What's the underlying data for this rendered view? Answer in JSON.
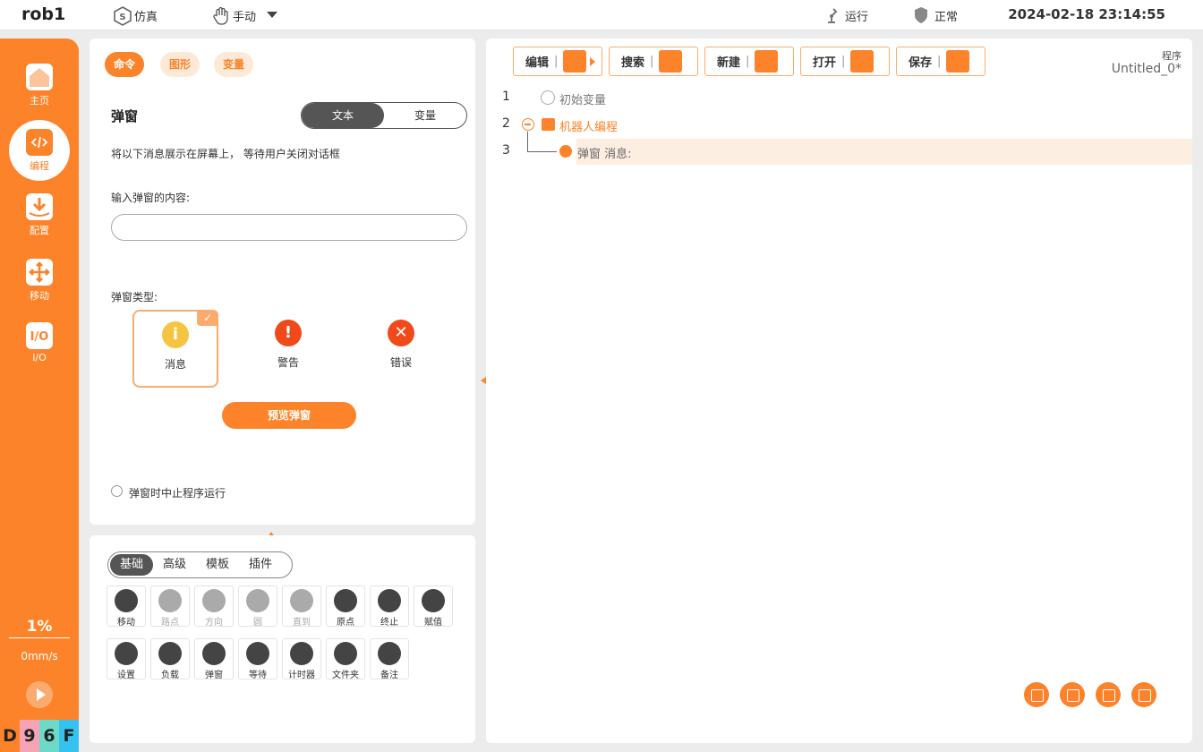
{
  "topbar": {
    "robot_name": "rob1",
    "mode": "仿真",
    "control": "手动",
    "run_status": "运行",
    "safety_status": "正常",
    "datetime": "2024-02-18 23:14:55"
  },
  "sidebar": {
    "items": [
      {
        "label": "主页",
        "icon": "home-icon"
      },
      {
        "label": "编程",
        "icon": "code-icon"
      },
      {
        "label": "配置",
        "icon": "download-icon"
      },
      {
        "label": "移动",
        "icon": "move-icon"
      },
      {
        "label": "I/O",
        "icon": "io-icon"
      }
    ],
    "speed_percent": "1%",
    "speed_value": "0mm/s",
    "code_chars": [
      "D",
      "9",
      "6",
      "F"
    ],
    "code_colors": [
      "#fc8329",
      "#f5a3b5",
      "#6fd9c8",
      "#35c2f0"
    ]
  },
  "command_panel": {
    "tabs": [
      "命令",
      "图形",
      "变量"
    ],
    "title": "弹窗",
    "segment": [
      "文本",
      "变量"
    ],
    "description": "将以下消息展示在屏幕上， 等待用户关闭对话框",
    "input_label": "输入弹窗的内容:",
    "input_value": "",
    "type_label": "弹窗类型:",
    "types": [
      {
        "label": "消息",
        "icon": "info-icon",
        "symbol": "i",
        "color": "#f5c542"
      },
      {
        "label": "警告",
        "icon": "warning-icon",
        "symbol": "!",
        "color": "#f04a1a"
      },
      {
        "label": "错误",
        "icon": "error-icon",
        "symbol": "✕",
        "color": "#f04a1a"
      }
    ],
    "check_mark": "✓",
    "preview_button": "预览弹窗",
    "stop_option": "弹窗时中止程序运行"
  },
  "block_panel": {
    "tabs": [
      "基础",
      "高级",
      "模板",
      "插件"
    ],
    "row1": [
      "移动",
      "路点",
      "方向",
      "圆",
      "直到",
      "原点",
      "终止",
      "赋值"
    ],
    "row2": [
      "设置",
      "负载",
      "弹窗",
      "等待",
      "计时器",
      "文件夹",
      "备注"
    ]
  },
  "program_panel": {
    "toolbar": [
      "编辑",
      "搜索",
      "新建",
      "打开",
      "保存"
    ],
    "toolbar_separator": "|",
    "program_label": "程序",
    "program_name": "Untitled_0*",
    "lines": [
      {
        "no": "1",
        "text": "初始变量",
        "color": "#777777"
      },
      {
        "no": "2",
        "text": "机器人编程",
        "color": "#fc8329"
      },
      {
        "no": "3",
        "text": "弹窗 消息:",
        "color": "#666666"
      }
    ]
  }
}
